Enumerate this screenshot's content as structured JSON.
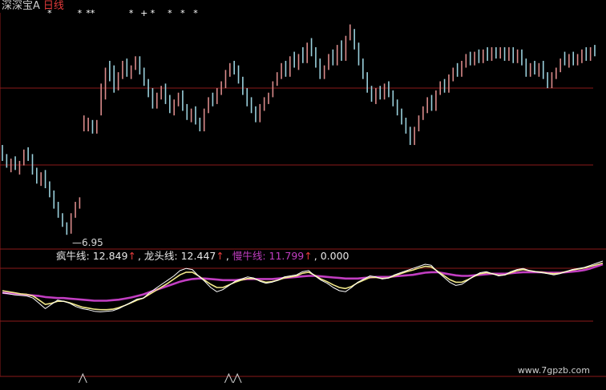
{
  "header": {
    "name": "深深宝A",
    "period": "日线"
  },
  "price_chart": {
    "low_label": "6.95"
  },
  "legend": [
    {
      "label": "疯牛线:",
      "value": "12.849",
      "arrow": "↑",
      "style": "normal"
    },
    {
      "label": "龙头线:",
      "value": "12.447",
      "arrow": "↑",
      "style": "normal"
    },
    {
      "label": "慢牛线:",
      "value": "11.799",
      "arrow": "↑",
      "style": "slow"
    },
    {
      "label": "",
      "value": "0.000",
      "arrow": "",
      "style": "normal"
    }
  ],
  "watermark": "www.7gpzb.com",
  "colors": {
    "background": "#000000",
    "grid": "#8b1a1a",
    "candle_up": "#d98a8a",
    "candle_down": "#9ad0dc",
    "line_crazy": "#ffffff",
    "line_dragon": "#f2e98a",
    "line_slow": "#c23ec2",
    "marker": "#ffffff"
  },
  "chart_data": {
    "type": "candlestick",
    "candles": [
      [
        10.6,
        10.9,
        10.2,
        10.4
      ],
      [
        10.4,
        10.5,
        9.9,
        10.0
      ],
      [
        10.0,
        10.3,
        9.7,
        10.1
      ],
      [
        10.1,
        10.4,
        9.8,
        9.9
      ],
      [
        9.9,
        10.2,
        9.6,
        10.1
      ],
      [
        10.1,
        10.7,
        10.0,
        10.6
      ],
      [
        10.6,
        10.8,
        10.2,
        10.3
      ],
      [
        10.3,
        10.5,
        9.6,
        9.7
      ],
      [
        9.7,
        9.9,
        9.2,
        9.3
      ],
      [
        9.3,
        9.7,
        9.1,
        9.6
      ],
      [
        9.6,
        9.8,
        9.0,
        9.1
      ],
      [
        9.1,
        9.3,
        8.6,
        8.7
      ],
      [
        8.7,
        8.9,
        8.1,
        8.2
      ],
      [
        8.2,
        8.4,
        7.7,
        7.8
      ],
      [
        7.8,
        7.9,
        7.3,
        7.4
      ],
      [
        7.4,
        7.5,
        6.95,
        7.1
      ],
      [
        7.1,
        7.9,
        7.0,
        7.8
      ],
      [
        7.8,
        8.4,
        7.7,
        8.3
      ],
      [
        8.3,
        8.6,
        8.1,
        8.5
      ],
      [
        11.6,
        12.2,
        11.5,
        11.6
      ],
      [
        11.6,
        12.1,
        11.5,
        11.9
      ],
      [
        11.9,
        12.0,
        11.4,
        11.5
      ],
      [
        11.5,
        12.0,
        11.4,
        11.6
      ],
      [
        12.4,
        13.6,
        12.2,
        13.1
      ],
      [
        13.1,
        14.3,
        12.9,
        14.0
      ],
      [
        14.0,
        14.6,
        13.7,
        13.9
      ],
      [
        13.9,
        14.4,
        13.2,
        13.4
      ],
      [
        13.4,
        14.1,
        13.3,
        14.0
      ],
      [
        14.0,
        14.6,
        13.8,
        14.5
      ],
      [
        14.5,
        14.7,
        13.9,
        14.1
      ],
      [
        14.1,
        14.4,
        13.8,
        14.3
      ],
      [
        14.3,
        14.8,
        14.2,
        14.6
      ],
      [
        14.6,
        14.8,
        14.0,
        14.1
      ],
      [
        14.1,
        14.3,
        13.5,
        13.6
      ],
      [
        13.6,
        13.8,
        13.0,
        13.1
      ],
      [
        13.1,
        13.4,
        12.5,
        12.6
      ],
      [
        12.6,
        13.2,
        12.5,
        13.1
      ],
      [
        13.1,
        13.5,
        12.9,
        13.3
      ],
      [
        13.3,
        13.6,
        12.7,
        12.8
      ],
      [
        12.8,
        13.1,
        12.3,
        12.4
      ],
      [
        12.4,
        12.9,
        12.2,
        12.8
      ],
      [
        12.8,
        13.2,
        12.6,
        13.0
      ],
      [
        13.0,
        13.3,
        12.4,
        12.5
      ],
      [
        12.5,
        12.7,
        12.0,
        12.1
      ],
      [
        12.1,
        12.5,
        11.9,
        12.4
      ],
      [
        12.4,
        12.6,
        11.8,
        11.9
      ],
      [
        11.9,
        12.1,
        11.5,
        11.6
      ],
      [
        11.6,
        12.5,
        11.5,
        12.4
      ],
      [
        12.4,
        13.0,
        12.3,
        12.9
      ],
      [
        12.9,
        13.2,
        12.6,
        12.8
      ],
      [
        12.8,
        13.4,
        12.7,
        13.3
      ],
      [
        13.3,
        13.7,
        13.1,
        13.6
      ],
      [
        13.6,
        14.2,
        13.4,
        14.0
      ],
      [
        14.0,
        14.5,
        13.9,
        14.4
      ],
      [
        14.4,
        14.6,
        14.0,
        14.1
      ],
      [
        14.1,
        14.4,
        13.6,
        13.7
      ],
      [
        13.7,
        13.9,
        13.1,
        13.2
      ],
      [
        13.2,
        13.4,
        12.6,
        12.7
      ],
      [
        12.7,
        13.0,
        12.3,
        12.4
      ],
      [
        12.4,
        12.6,
        11.9,
        12.0
      ],
      [
        12.0,
        12.7,
        11.9,
        12.6
      ],
      [
        12.6,
        13.0,
        12.4,
        12.9
      ],
      [
        12.9,
        13.2,
        12.7,
        13.1
      ],
      [
        13.1,
        13.7,
        13.0,
        13.6
      ],
      [
        13.6,
        14.1,
        13.5,
        14.0
      ],
      [
        14.0,
        14.5,
        13.8,
        14.3
      ],
      [
        14.3,
        14.6,
        13.9,
        14.0
      ],
      [
        14.0,
        14.8,
        13.9,
        14.7
      ],
      [
        14.7,
        15.0,
        14.3,
        14.4
      ],
      [
        14.4,
        14.9,
        14.2,
        14.8
      ],
      [
        14.8,
        15.2,
        14.5,
        14.6
      ],
      [
        14.6,
        15.4,
        14.5,
        15.3
      ],
      [
        15.3,
        15.6,
        14.8,
        14.9
      ],
      [
        14.9,
        15.2,
        14.3,
        14.4
      ],
      [
        14.4,
        14.7,
        13.8,
        13.9
      ],
      [
        13.9,
        14.4,
        13.8,
        14.3
      ],
      [
        14.3,
        14.9,
        14.2,
        14.8
      ],
      [
        14.8,
        15.1,
        14.4,
        14.5
      ],
      [
        14.5,
        15.3,
        14.4,
        15.2
      ],
      [
        15.2,
        15.5,
        14.6,
        14.7
      ],
      [
        14.7,
        15.7,
        14.6,
        15.6
      ],
      [
        15.6,
        16.2,
        15.5,
        15.8
      ],
      [
        15.8,
        16.0,
        15.1,
        15.2
      ],
      [
        15.2,
        15.4,
        14.4,
        14.5
      ],
      [
        14.5,
        14.7,
        13.8,
        13.9
      ],
      [
        13.9,
        14.1,
        13.2,
        13.3
      ],
      [
        13.3,
        13.5,
        12.8,
        12.9
      ],
      [
        12.9,
        13.4,
        12.7,
        13.3
      ],
      [
        13.3,
        13.5,
        12.9,
        13.0
      ],
      [
        13.0,
        13.6,
        12.9,
        13.5
      ],
      [
        13.5,
        13.7,
        13.0,
        13.1
      ],
      [
        13.1,
        13.3,
        12.6,
        12.7
      ],
      [
        12.7,
        12.9,
        12.2,
        12.3
      ],
      [
        12.3,
        12.5,
        11.8,
        11.9
      ],
      [
        11.9,
        12.1,
        11.4,
        11.5
      ],
      [
        11.5,
        11.7,
        10.9,
        11.0
      ],
      [
        11.0,
        11.7,
        10.9,
        11.6
      ],
      [
        11.6,
        12.2,
        11.5,
        12.1
      ],
      [
        12.1,
        12.6,
        12.0,
        12.5
      ],
      [
        12.5,
        13.0,
        12.3,
        12.9
      ],
      [
        12.9,
        13.1,
        12.4,
        12.5
      ],
      [
        12.5,
        13.3,
        12.4,
        13.2
      ],
      [
        13.2,
        13.7,
        13.1,
        13.6
      ],
      [
        13.6,
        13.8,
        13.2,
        13.3
      ],
      [
        13.3,
        14.0,
        13.2,
        13.9
      ],
      [
        13.9,
        14.3,
        13.7,
        14.2
      ],
      [
        14.2,
        14.5,
        13.9,
        14.0
      ],
      [
        14.0,
        14.6,
        13.9,
        14.5
      ],
      [
        14.5,
        14.9,
        14.3,
        14.8
      ],
      [
        14.8,
        15.0,
        14.4,
        14.5
      ],
      [
        14.5,
        15.0,
        14.4,
        14.9
      ],
      [
        14.9,
        15.1,
        14.5,
        14.6
      ],
      [
        14.6,
        15.1,
        14.5,
        15.0
      ],
      [
        15.0,
        15.2,
        14.6,
        14.7
      ],
      [
        14.7,
        15.2,
        14.6,
        15.1
      ],
      [
        15.1,
        15.2,
        14.7,
        14.8
      ],
      [
        14.8,
        15.2,
        14.7,
        15.1
      ],
      [
        15.1,
        15.2,
        14.6,
        14.7
      ],
      [
        14.7,
        15.2,
        14.6,
        15.1
      ],
      [
        15.1,
        15.2,
        14.5,
        14.6
      ],
      [
        14.6,
        15.1,
        14.5,
        15.0
      ],
      [
        15.0,
        15.1,
        14.4,
        14.5
      ],
      [
        14.5,
        14.7,
        13.9,
        14.0
      ],
      [
        14.0,
        14.5,
        13.9,
        14.4
      ],
      [
        14.4,
        14.6,
        14.0,
        14.1
      ],
      [
        14.1,
        14.5,
        13.9,
        14.4
      ],
      [
        14.4,
        14.6,
        13.8,
        13.9
      ],
      [
        13.9,
        14.1,
        13.4,
        13.5
      ],
      [
        13.5,
        14.1,
        13.4,
        14.0
      ],
      [
        14.0,
        14.3,
        13.8,
        14.2
      ],
      [
        14.2,
        14.7,
        14.1,
        14.6
      ],
      [
        14.6,
        15.0,
        14.4,
        14.5
      ],
      [
        14.5,
        14.9,
        14.3,
        14.8
      ],
      [
        14.8,
        15.0,
        14.4,
        14.5
      ],
      [
        14.5,
        14.9,
        14.4,
        14.8
      ],
      [
        14.8,
        15.1,
        14.5,
        15.0
      ],
      [
        15.0,
        15.2,
        14.6,
        14.7
      ],
      [
        14.7,
        15.2,
        14.6,
        15.1
      ],
      [
        15.1,
        15.3,
        14.8,
        14.9
      ]
    ],
    "crazy_line": [
      0.4,
      0.38,
      0.36,
      0.35,
      0.34,
      0.3,
      0.2,
      0.1,
      0.18,
      0.26,
      0.24,
      0.2,
      0.14,
      0.1,
      0.08,
      0.05,
      0.04,
      0.05,
      0.06,
      0.1,
      0.16,
      0.22,
      0.28,
      0.3,
      0.4,
      0.48,
      0.56,
      0.64,
      0.72,
      0.82,
      0.86,
      0.84,
      0.72,
      0.62,
      0.5,
      0.42,
      0.46,
      0.54,
      0.62,
      0.66,
      0.7,
      0.68,
      0.62,
      0.58,
      0.6,
      0.64,
      0.7,
      0.72,
      0.74,
      0.8,
      0.82,
      0.72,
      0.64,
      0.58,
      0.5,
      0.44,
      0.42,
      0.5,
      0.6,
      0.66,
      0.72,
      0.7,
      0.66,
      0.68,
      0.74,
      0.78,
      0.82,
      0.86,
      0.9,
      0.94,
      0.92,
      0.8,
      0.7,
      0.6,
      0.54,
      0.56,
      0.64,
      0.72,
      0.78,
      0.8,
      0.76,
      0.72,
      0.74,
      0.8,
      0.84,
      0.86,
      0.82,
      0.8,
      0.78,
      0.76,
      0.74,
      0.76,
      0.8,
      0.84,
      0.86,
      0.88,
      0.92,
      0.96,
      1.0
    ],
    "dragon_line": [
      0.44,
      0.42,
      0.4,
      0.38,
      0.37,
      0.34,
      0.26,
      0.18,
      0.2,
      0.24,
      0.24,
      0.21,
      0.17,
      0.13,
      0.11,
      0.09,
      0.08,
      0.08,
      0.09,
      0.12,
      0.16,
      0.21,
      0.26,
      0.3,
      0.37,
      0.44,
      0.51,
      0.58,
      0.66,
      0.74,
      0.79,
      0.79,
      0.72,
      0.64,
      0.56,
      0.5,
      0.5,
      0.55,
      0.6,
      0.64,
      0.67,
      0.67,
      0.63,
      0.6,
      0.61,
      0.64,
      0.68,
      0.7,
      0.72,
      0.77,
      0.79,
      0.73,
      0.66,
      0.61,
      0.55,
      0.5,
      0.48,
      0.52,
      0.59,
      0.64,
      0.69,
      0.69,
      0.67,
      0.68,
      0.72,
      0.76,
      0.8,
      0.83,
      0.87,
      0.9,
      0.89,
      0.81,
      0.73,
      0.65,
      0.6,
      0.6,
      0.65,
      0.71,
      0.76,
      0.78,
      0.76,
      0.73,
      0.74,
      0.78,
      0.82,
      0.84,
      0.82,
      0.8,
      0.79,
      0.77,
      0.76,
      0.77,
      0.8,
      0.83,
      0.85,
      0.87,
      0.9,
      0.93,
      0.96
    ],
    "slow_line": [
      0.4,
      0.39,
      0.38,
      0.37,
      0.36,
      0.35,
      0.34,
      0.32,
      0.31,
      0.3,
      0.3,
      0.29,
      0.28,
      0.27,
      0.26,
      0.25,
      0.25,
      0.25,
      0.26,
      0.27,
      0.29,
      0.31,
      0.34,
      0.37,
      0.41,
      0.45,
      0.49,
      0.53,
      0.57,
      0.61,
      0.64,
      0.66,
      0.67,
      0.67,
      0.66,
      0.65,
      0.64,
      0.64,
      0.64,
      0.65,
      0.66,
      0.66,
      0.66,
      0.66,
      0.66,
      0.67,
      0.68,
      0.69,
      0.7,
      0.71,
      0.72,
      0.72,
      0.71,
      0.7,
      0.69,
      0.68,
      0.67,
      0.67,
      0.67,
      0.68,
      0.69,
      0.7,
      0.7,
      0.7,
      0.71,
      0.72,
      0.73,
      0.74,
      0.76,
      0.78,
      0.79,
      0.79,
      0.77,
      0.75,
      0.73,
      0.72,
      0.72,
      0.73,
      0.74,
      0.75,
      0.76,
      0.76,
      0.76,
      0.77,
      0.78,
      0.79,
      0.79,
      0.79,
      0.79,
      0.78,
      0.78,
      0.78,
      0.79,
      0.8,
      0.81,
      0.83,
      0.86,
      0.9,
      0.94
    ],
    "top_markers": [
      {
        "index": 11,
        "symbol": "*"
      },
      {
        "index": 18,
        "symbol": "*"
      },
      {
        "index": 20,
        "symbol": "*"
      },
      {
        "index": 21,
        "symbol": "*"
      },
      {
        "index": 30,
        "symbol": "*"
      },
      {
        "index": 33,
        "symbol": "+"
      },
      {
        "index": 35,
        "symbol": "*"
      },
      {
        "index": 39,
        "symbol": "*"
      },
      {
        "index": 42,
        "symbol": "*"
      },
      {
        "index": 45,
        "symbol": "*"
      }
    ],
    "bottom_markers": [
      15,
      49,
      51
    ],
    "price_range": [
      6.5,
      16.5
    ]
  }
}
